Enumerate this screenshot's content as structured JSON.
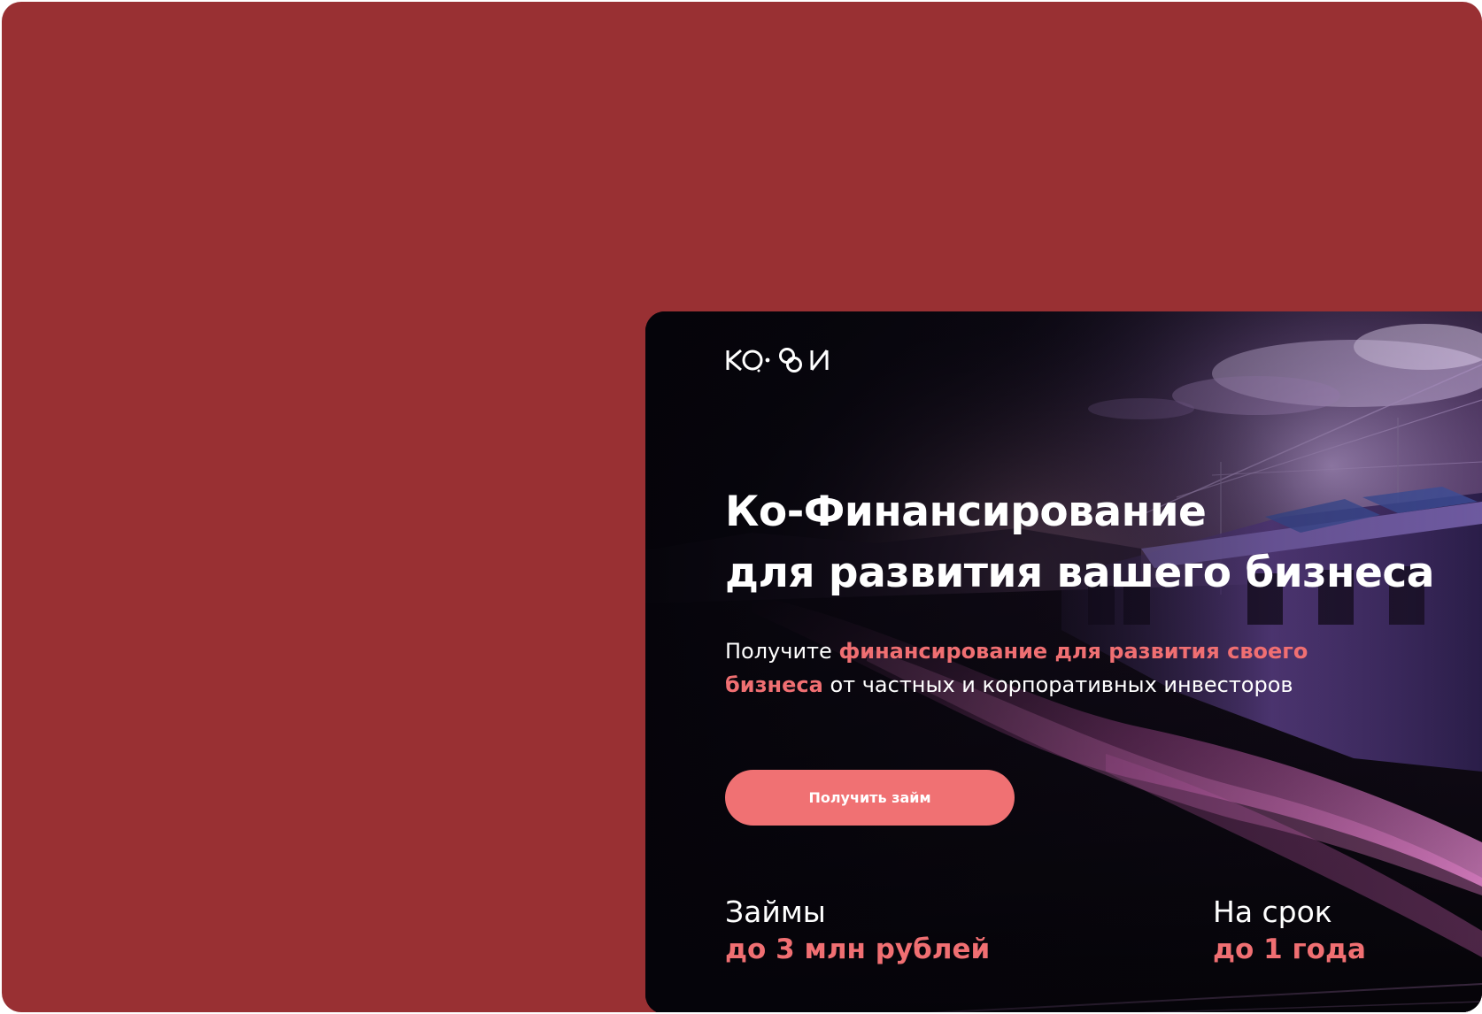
{
  "brand": {
    "logo_text": "КО·ФИ"
  },
  "hero": {
    "title_line1": "Ко-Финансирование",
    "title_line2": "для развития вашего бизнеса",
    "subtitle_prefix": "Получите ",
    "subtitle_highlight": "финансирование для развития своего бизнеса",
    "subtitle_suffix": " от частных и корпоративных инвесторов",
    "cta_label": "Получить займ"
  },
  "stats": [
    {
      "label": "Займы",
      "value": "до 3 млн рублей"
    },
    {
      "label": "На срок",
      "value": "до 1 года"
    }
  ],
  "colors": {
    "backdrop": "#993033",
    "accent": "#f06f72",
    "hero_dark": "#07060c",
    "text": "#ffffff"
  }
}
